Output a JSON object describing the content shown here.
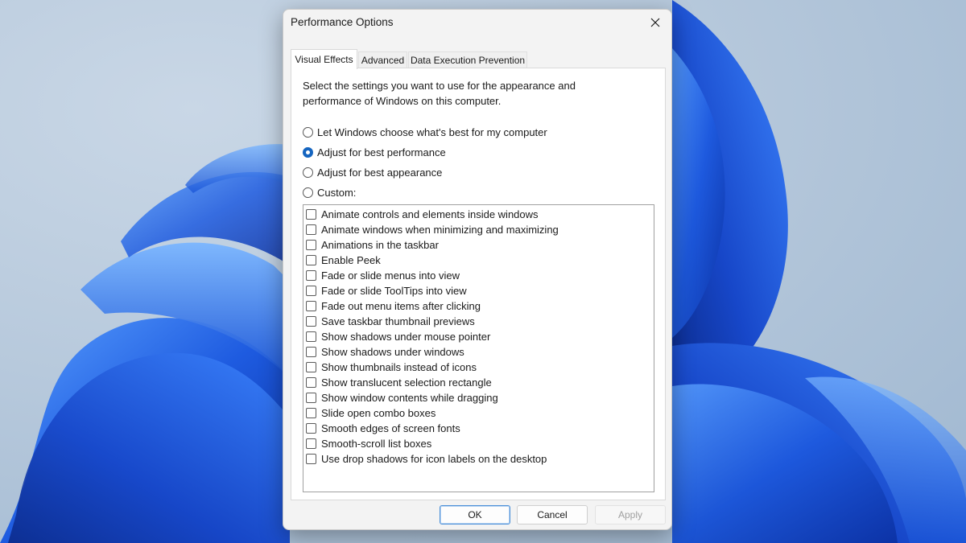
{
  "window": {
    "title": "Performance Options"
  },
  "tabs": [
    {
      "label": "Visual Effects",
      "active": true
    },
    {
      "label": "Advanced",
      "active": false
    },
    {
      "label": "Data Execution Prevention",
      "active": false
    }
  ],
  "visual_effects": {
    "description_line1": "Select the settings you want to use for the appearance and",
    "description_line2": "performance of Windows on this computer.",
    "options": [
      {
        "label": "Let Windows choose what's best for my computer",
        "selected": false
      },
      {
        "label": "Adjust for best performance",
        "selected": true
      },
      {
        "label": "Adjust for best appearance",
        "selected": false
      },
      {
        "label": "Custom:",
        "selected": false
      }
    ],
    "effects": [
      {
        "label": "Animate controls and elements inside windows",
        "checked": false
      },
      {
        "label": "Animate windows when minimizing and maximizing",
        "checked": false
      },
      {
        "label": "Animations in the taskbar",
        "checked": false
      },
      {
        "label": "Enable Peek",
        "checked": false
      },
      {
        "label": "Fade or slide menus into view",
        "checked": false
      },
      {
        "label": "Fade or slide ToolTips into view",
        "checked": false
      },
      {
        "label": "Fade out menu items after clicking",
        "checked": false
      },
      {
        "label": "Save taskbar thumbnail previews",
        "checked": false
      },
      {
        "label": "Show shadows under mouse pointer",
        "checked": false
      },
      {
        "label": "Show shadows under windows",
        "checked": false
      },
      {
        "label": "Show thumbnails instead of icons",
        "checked": false
      },
      {
        "label": "Show translucent selection rectangle",
        "checked": false
      },
      {
        "label": "Show window contents while dragging",
        "checked": false
      },
      {
        "label": "Slide open combo boxes",
        "checked": false
      },
      {
        "label": "Smooth edges of screen fonts",
        "checked": false
      },
      {
        "label": "Smooth-scroll list boxes",
        "checked": false
      },
      {
        "label": "Use drop shadows for icon labels on the desktop",
        "checked": false
      }
    ]
  },
  "buttons": {
    "ok": "OK",
    "cancel": "Cancel",
    "apply": "Apply"
  },
  "icons": {
    "close": "close-icon"
  },
  "colors": {
    "accent": "#1565c0",
    "wallpaper_blue": "#1e5be0"
  }
}
